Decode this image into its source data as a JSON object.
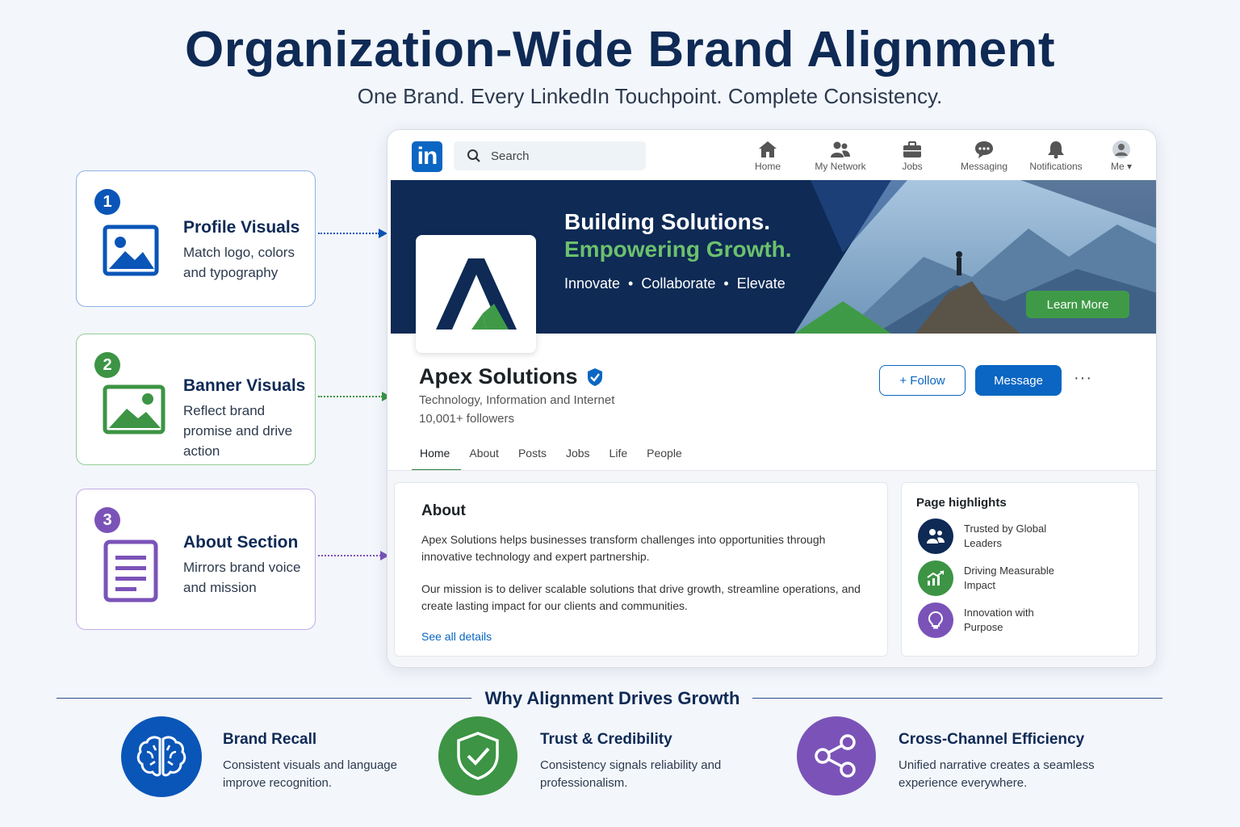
{
  "header": {
    "title": "Organization-Wide Brand Alignment",
    "subtitle": "One Brand. Every LinkedIn Touchpoint. Complete Consistency."
  },
  "callouts": [
    {
      "number": "1",
      "title": "Profile Visuals",
      "text": "Match logo, colors and typography",
      "color": "#0a55b8"
    },
    {
      "number": "2",
      "title": "Banner Visuals",
      "text": "Reflect brand promise and drive action",
      "color": "#3c9444"
    },
    {
      "number": "3",
      "title": "About Section",
      "text": "Mirrors brand voice and mission",
      "color": "#7b53b8"
    }
  ],
  "linkedin": {
    "logo": "in",
    "search_placeholder": "Search",
    "nav": [
      {
        "label": "Home",
        "icon": "home-icon"
      },
      {
        "label": "My Network",
        "icon": "network-icon"
      },
      {
        "label": "Jobs",
        "icon": "briefcase-icon"
      },
      {
        "label": "Messaging",
        "icon": "messaging-icon"
      },
      {
        "label": "Notifications",
        "icon": "bell-icon"
      },
      {
        "label": "Me ▾",
        "icon": "avatar-icon"
      }
    ],
    "banner": {
      "headline1": "Building Solutions.",
      "headline2": "Empowering Growth.",
      "tagline": "Innovate  •  Collaborate  •  Elevate",
      "cta": "Learn More"
    },
    "company": {
      "name": "Apex Solutions",
      "industry": "Technology, Information and Internet",
      "followers": "10,001+ followers",
      "follow_label": "+ Follow",
      "message_label": "Message",
      "more_label": "···"
    },
    "tabs": [
      "Home",
      "About",
      "Posts",
      "Jobs",
      "Life",
      "People"
    ],
    "active_tab": "Home",
    "about": {
      "title": "About",
      "paragraph1": "Apex Solutions helps businesses transform challenges into opportunities through innovative technology and expert partnership.",
      "paragraph2": "Our mission is to deliver scalable solutions that drive growth, streamline operations, and create lasting impact for our clients and communities.",
      "link": "See all details"
    },
    "highlights": {
      "title": "Page highlights",
      "items": [
        {
          "text": "Trusted by Global Leaders",
          "color": "#0e2a55",
          "icon": "people-icon"
        },
        {
          "text": "Driving Measurable Impact",
          "color": "#3c9444",
          "icon": "growth-chart-icon"
        },
        {
          "text": "Innovation with Purpose",
          "color": "#7b53b8",
          "icon": "lightbulb-icon"
        }
      ]
    }
  },
  "bottom": {
    "title": "Why Alignment Drives Growth",
    "benefits": [
      {
        "title": "Brand Recall",
        "text": "Consistent visuals and language improve recognition.",
        "color": "#0a55b8",
        "icon": "brain-icon"
      },
      {
        "title": "Trust & Credibility",
        "text": "Consistency signals reliability and professionalism.",
        "color": "#3c9444",
        "icon": "shield-check-icon"
      },
      {
        "title": "Cross-Channel Efficiency",
        "text": "Unified narrative creates a seamless experience everywhere.",
        "color": "#7b53b8",
        "icon": "share-icon"
      }
    ]
  }
}
